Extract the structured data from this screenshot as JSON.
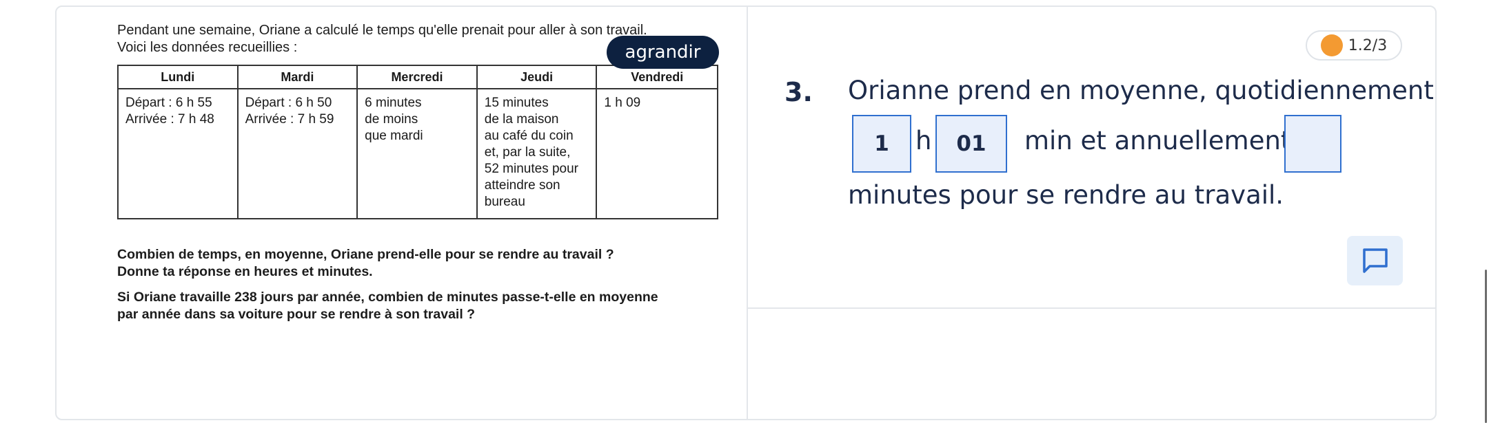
{
  "document": {
    "intro_line1": "Pendant une semaine, Oriane a calculé le temps qu'elle prenait pour aller à son travail.",
    "intro_line2": "Voici les données recueillies :",
    "table": {
      "headers": [
        "Lundi",
        "Mardi",
        "Mercredi",
        "Jeudi",
        "Vendredi"
      ],
      "cells": [
        "Départ : 6 h 55\nArrivée : 7 h 48",
        "Départ : 6 h 50\nArrivée : 7 h 59",
        "6 minutes\nde moins\nque mardi",
        "15 minutes\nde la maison\nau café du coin\net, par la suite,\n52 minutes pour\natteindre son\nbureau",
        "1 h 09"
      ]
    },
    "question1": "Combien de temps, en moyenne, Oriane prend-elle pour se rendre au travail ?\nDonne ta réponse en heures et minutes.",
    "question2": "Si Oriane travaille 238 jours par année, combien de minutes passe-t-elle en moyenne\npar année dans sa voiture pour se rendre à son travail ?"
  },
  "zoom_button": "agrandir",
  "progress_badge": {
    "label": "1.2/3",
    "dot_color": "#f39a32"
  },
  "exercise": {
    "number": "3.",
    "text_line1": "Orianne prend en moyenne, quotidiennement",
    "hours_value": "1",
    "h_label": "h",
    "minutes_value": "01",
    "text_mid": "min et annuellement",
    "annual_value": "",
    "text_line3": "minutes pour se rendre au travail."
  },
  "comment_icon": "comment-icon",
  "colors": {
    "accent": "#2f6fcf",
    "text_dark": "#1d2b4a",
    "button_dark": "#0d2140"
  }
}
